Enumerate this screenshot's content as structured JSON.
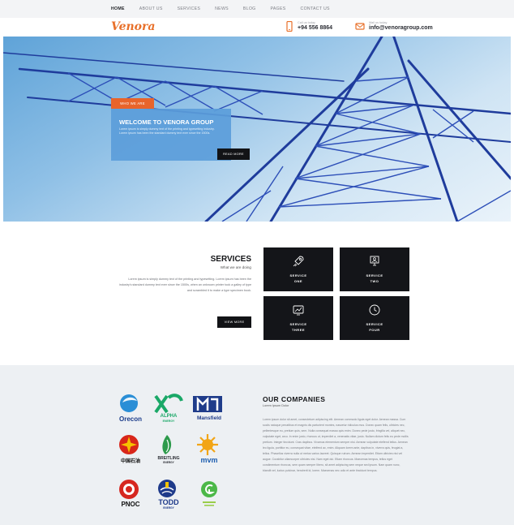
{
  "nav": {
    "items": [
      {
        "label": "HOME",
        "active": true
      },
      {
        "label": "ABOUT US"
      },
      {
        "label": "SERVICES"
      },
      {
        "label": "NEWS"
      },
      {
        "label": "BLOG"
      },
      {
        "label": "PAGES"
      },
      {
        "label": "CONTACT US"
      }
    ]
  },
  "header": {
    "logo": "Venora",
    "phone_label": "Call us today",
    "phone": "+94 556 8864",
    "email_label": "Mail us today",
    "email": "info@venoragroup.com",
    "accent_color": "#e8702a"
  },
  "hero": {
    "tag": "WHO WE ARE",
    "title": "WELCOME TO VENORA GROUP",
    "text": "Lorem ipsum is simply dummy text of the printing and typesetting industry. Lorem ipsum has been the standard dummy text ever since the 1500s.",
    "button": "READ MORE"
  },
  "services": {
    "title": "SERVICES",
    "subtitle": "What we are doing",
    "text": "Lorem ipsum is simply dummy text of the printing and typesetting. Lorem ipsum has been the industry's standard dummy text ever since the 1500s, when an unknown printer took a galley of type and scrambled it to make a type specimen book.",
    "button": "VIEW MORE",
    "tiles": [
      {
        "line1": "SERVICE",
        "line2": "ONE",
        "icon": "rocket-icon"
      },
      {
        "line1": "SERVICE",
        "line2": "TWO",
        "icon": "monitor-person-icon"
      },
      {
        "line1": "SERVICE",
        "line2": "THREE",
        "icon": "chart-screen-icon"
      },
      {
        "line1": "SERVICE",
        "line2": "FOUR",
        "icon": "clock-icon"
      }
    ]
  },
  "companies": {
    "title": "OUR COMPANIES",
    "subtitle": "Lorem Ipsum Dolor",
    "text": "Lorem ipsum dolor sit amet, consectetuer adipiscing elit. Aenean commodo ligula eget dolor. Aenean massa. Cum sociis natoque penatibus et magnis dis parturient montes, nascetur ridiculus mus. Donec quam felis, ultricies nec, pellentesque eu, pretium quis, sem. Nulla consequat massa quis enim. Donec pede justo, fringilla vel, aliquet nec, vulputate eget, arcu. In enim justo, rhoncus ut, imperdiet a, venenatis vitae, justo. Nullam dictum felis eu pede mollis pretium. Integer tincidunt. Cras dapibus. Vivamus elementum semper nisi. Aenean vulputate eleifend tellus. Aenean leo ligula, porttitor eu, consequat vitae, eleifend ac, enim. Aliquam lorem ante, dapibus in, viverra quis, feugiat a, tellus. Phasellus viverra nulla ut metus varius laoreet. Quisque rutrum. Aenean imperdiet. Etiam ultricies nisi vel augue. Curabitur ullamcorper ultricies nisi. Nam eget dui. Etiam rhoncus. Maecenas tempus, tellus eget condimentum rhoncus, sem quam semper libero, sit amet adipiscing sem neque sed ipsum. Nam quam nunc, blandit vel, luctus pulvinar, hendrerit id, lorem. Maecenas nec odio et ante tincidunt tempus.",
    "logos": [
      {
        "name": "Orecon",
        "sub": "",
        "icon": "orecon-logo-icon"
      },
      {
        "name": "ALPHA",
        "sub": "ENERGY",
        "icon": "alpha-logo-icon"
      },
      {
        "name": "Mansfield",
        "sub": "",
        "icon": "mansfield-logo-icon"
      },
      {
        "name": "中国石油",
        "sub": "",
        "icon": "petrochina-logo-icon"
      },
      {
        "name": "BREITLING",
        "sub": "ENERGY",
        "icon": "breitling-logo-icon"
      },
      {
        "name": "mvm",
        "sub": "",
        "icon": "mvm-logo-icon"
      },
      {
        "name": "PNOC",
        "sub": "",
        "icon": "pnoc-logo-icon"
      },
      {
        "name": "TODD",
        "sub": "ENERGY",
        "icon": "todd-logo-icon"
      },
      {
        "name": "",
        "sub": "",
        "icon": "green-power-logo-icon"
      }
    ]
  }
}
